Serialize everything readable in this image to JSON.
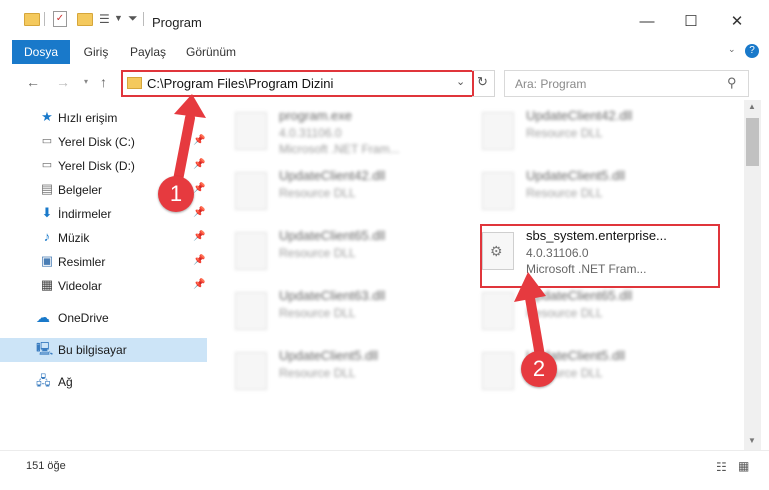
{
  "window": {
    "title": "Program",
    "minimize_glyph": "—",
    "maximize_glyph": "☐",
    "close_glyph": "✕"
  },
  "ribbon": {
    "tabs": [
      "Dosya",
      "Giriş",
      "Paylaş",
      "Görünüm"
    ],
    "help_glyph": "?"
  },
  "address": {
    "path": "C:\\Program Files\\Program Dizini",
    "search_placeholder": "Ara: Program"
  },
  "nav": {
    "items": [
      {
        "label": "Hızlı erişim",
        "icon": "star-icon",
        "pinned": false
      },
      {
        "label": "Yerel Disk (C:)",
        "icon": "drive-icon",
        "pinned": true
      },
      {
        "label": "Yerel Disk (D:)",
        "icon": "drive-icon",
        "pinned": true
      },
      {
        "label": "Belgeler",
        "icon": "document-icon",
        "pinned": true
      },
      {
        "label": "İndirmeler",
        "icon": "download-icon",
        "pinned": true
      },
      {
        "label": "Müzik",
        "icon": "music-icon",
        "pinned": true
      },
      {
        "label": "Resimler",
        "icon": "pictures-icon",
        "pinned": true
      },
      {
        "label": "Videolar",
        "icon": "video-icon",
        "pinned": true
      },
      {
        "label": "OneDrive",
        "icon": "cloud-icon",
        "pinned": false
      },
      {
        "label": "Bu bilgisayar",
        "icon": "computer-icon",
        "pinned": false,
        "selected": true
      },
      {
        "label": "Ağ",
        "icon": "network-icon",
        "pinned": false
      }
    ]
  },
  "files": [
    {
      "name": "program.exe",
      "version": "4.0.31106.0",
      "desc": "Microsoft .NET Fram...",
      "blurred": true
    },
    {
      "name": "UpdateClient42.dll",
      "version": "Resource DLL",
      "desc": "",
      "blurred": true
    },
    {
      "name": "UpdateClient42.dll",
      "version": "Resource DLL",
      "desc": "",
      "blurred": true
    },
    {
      "name": "UpdateClient5.dll",
      "version": "Resource DLL",
      "desc": "",
      "blurred": true
    },
    {
      "name": "UpdateClient65.dll",
      "version": "Resource DLL",
      "desc": "",
      "blurred": true
    },
    {
      "name": "sbs_system.enterprise...",
      "version": "4.0.31106.0",
      "desc": "Microsoft .NET Fram...",
      "blurred": false
    },
    {
      "name": "UpdateClient63.dll",
      "version": "Resource DLL",
      "desc": "",
      "blurred": true
    },
    {
      "name": "UpdateClient65.dll",
      "version": "Resource DLL",
      "desc": "",
      "blurred": true
    },
    {
      "name": "UpdateClient5.dll",
      "version": "Resource DLL",
      "desc": "",
      "blurred": true
    },
    {
      "name": "UpdateClient5.dll",
      "version": "Resource DLL",
      "desc": "",
      "blurred": true
    }
  ],
  "status": {
    "item_count": "151 öğe"
  },
  "annotations": {
    "step1": "1",
    "step2": "2",
    "color": "#e0353b"
  }
}
